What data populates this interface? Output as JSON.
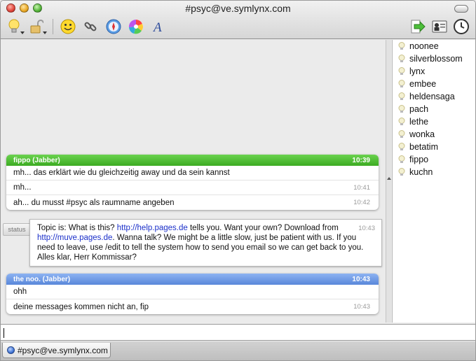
{
  "window": {
    "title": "#psyc@ve.symlynx.com"
  },
  "toolbar": {
    "left_icons": [
      "bulb-icon",
      "lock-icon",
      "smiley-icon",
      "link-icon",
      "safari-compass-icon",
      "color-wheel-icon",
      "font-icon"
    ],
    "right_icons": [
      "enter-arrow-icon",
      "user-card-icon",
      "clock-icon"
    ]
  },
  "messages": [
    {
      "header": {
        "name": "fippo (Jabber)",
        "time": "10:39"
      },
      "lines": [
        {
          "text": "mh... das erklärt wie du gleichzeitig away und da sein kannst",
          "time": ""
        },
        {
          "text": "mh...",
          "time": "10:41"
        },
        {
          "text": "ah... du musst #psyc als raumname angeben",
          "time": "10:42"
        }
      ]
    },
    {
      "header": {
        "name": "the noo. (Jabber)",
        "time": "10:43"
      },
      "lines": [
        {
          "text": "ohh",
          "time": ""
        },
        {
          "text": "deine messages kommen nicht an, fip",
          "time": "10:43"
        }
      ]
    }
  ],
  "status": {
    "label": "status",
    "time": "10:43",
    "part1": "Topic is: What is this? ",
    "link1": "http://help.pages.de",
    "part2": " tells you. Want your own? Download from ",
    "link2": "http://muve.pages.de",
    "part3": ". Wanna talk? We might be a little slow, just be patient with us. If you need to leave, use /edit to tell the system how to send you email so we can get back to you. Alles klar, Herr Kommissar?"
  },
  "users": [
    "noonee",
    "silverblossom",
    "lynx",
    "embee",
    "heldensaga",
    "pach",
    "lethe",
    "wonka",
    "betatim",
    "fippo",
    "kuchn"
  ],
  "input": {
    "value": ""
  },
  "tabs": [
    {
      "label": "#psyc@ve.symlynx.com"
    }
  ],
  "colors": {
    "green_header": "#3cab22",
    "blue_header": "#5987da",
    "link": "#1a2fc9"
  }
}
